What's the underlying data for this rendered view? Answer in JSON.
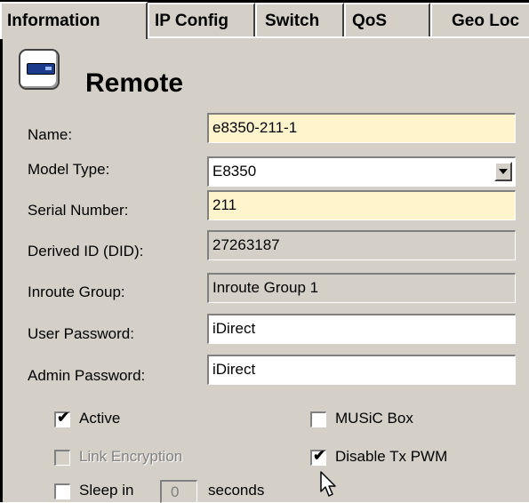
{
  "tabs": [
    {
      "label": "Information",
      "active": true
    },
    {
      "label": "IP Config",
      "active": false
    },
    {
      "label": "Switch",
      "active": false
    },
    {
      "label": "QoS",
      "active": false
    },
    {
      "label": "Geo Loc",
      "active": false
    }
  ],
  "header": {
    "icon": "remote-device-icon",
    "title": "Remote"
  },
  "fields": {
    "name": {
      "label": "Name:",
      "value": "e8350-211-1"
    },
    "model_type": {
      "label": "Model Type:",
      "value": "E8350"
    },
    "serial_number": {
      "label": "Serial Number:",
      "value": "211"
    },
    "derived_id": {
      "label": "Derived ID (DID):",
      "value": "27263187"
    },
    "inroute_group": {
      "label": "Inroute Group:",
      "value": "Inroute Group 1"
    },
    "user_password": {
      "label": "User Password:",
      "value": "iDirect"
    },
    "admin_password": {
      "label": "Admin Password:",
      "value": "iDirect"
    }
  },
  "checkboxes": {
    "active": {
      "label": "Active",
      "checked": true,
      "enabled": true
    },
    "link_encryption": {
      "label": "Link Encryption",
      "checked": false,
      "enabled": false
    },
    "sleep_in": {
      "label": "Sleep in",
      "checked": false,
      "enabled": true
    },
    "music_box": {
      "label": "MUSiC Box",
      "checked": false,
      "enabled": true
    },
    "disable_tx_pwm": {
      "label": "Disable Tx PWM",
      "checked": true,
      "enabled": true
    }
  },
  "sleep": {
    "value": "0",
    "unit": "seconds"
  },
  "colors": {
    "window_bg": "#d4d0c8",
    "required_field_bg": "#fff4cc",
    "device_icon": "#1a3b8c"
  }
}
